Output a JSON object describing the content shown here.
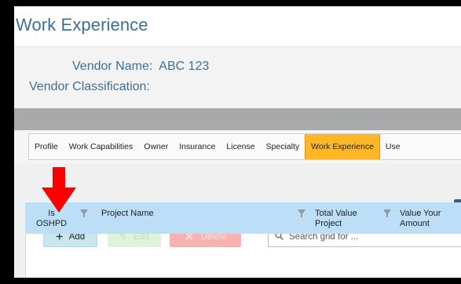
{
  "page": {
    "title": "Work Experience"
  },
  "vendor": {
    "name_label": "Vendor Name:",
    "name_value": "ABC 123",
    "classification_label": "Vendor Classification:"
  },
  "tabs": [
    {
      "label": "Profile"
    },
    {
      "label": "Work Capabilities"
    },
    {
      "label": "Owner"
    },
    {
      "label": "Insurance"
    },
    {
      "label": "License"
    },
    {
      "label": "Specialty"
    },
    {
      "label": "Work Experience",
      "active": true
    },
    {
      "label": "Use"
    }
  ],
  "toolbar": {
    "add_label": "Add",
    "edit_label": "Edit",
    "delete_label": "Delete",
    "search_placeholder": "Search grid for ..."
  },
  "grid": {
    "columns": {
      "is_oshpd_line1": "Is",
      "is_oshpd_line2": "OSHPD",
      "project_name": "Project Name",
      "total_value_line1": "Total Value",
      "total_value_line2": "Project",
      "value_your_line1": "Value Your",
      "value_your_line2": "Amount"
    }
  },
  "icons": {
    "add": "plus-icon",
    "edit": "pencil-icon",
    "delete": "close-icon",
    "search": "search-icon",
    "filter": "filter-icon",
    "annotation": "red-down-arrow"
  },
  "colors": {
    "title": "#3f6f95",
    "active_tab": "#ffb627",
    "add_button": "#c9e7ee",
    "edit_button": "#dff3da",
    "delete_button": "#f6b2ae",
    "grid_header": "#bcdff7",
    "arrow": "#ff0000"
  }
}
